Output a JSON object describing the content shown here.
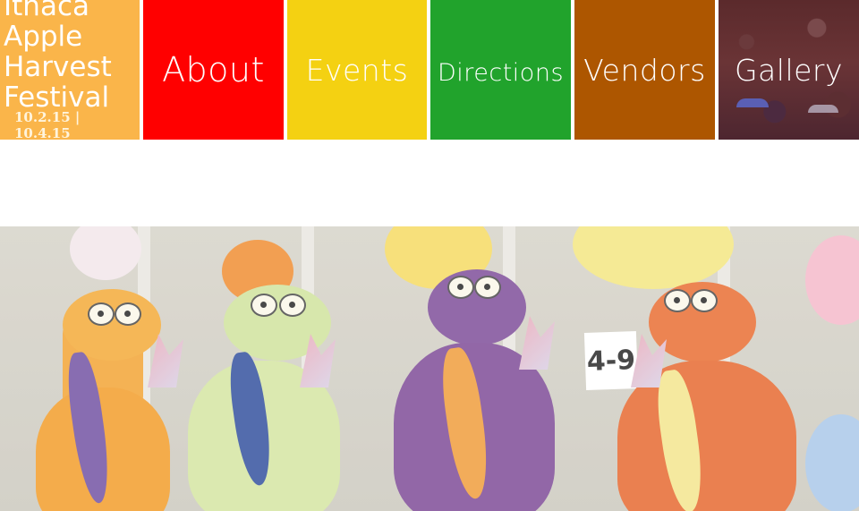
{
  "logo": {
    "lines": [
      "Ithaca",
      "Apple",
      "Harvest",
      "Festival"
    ],
    "dates": "10.2.15 | 10.4.15",
    "color": "#fab54a"
  },
  "nav": {
    "items": [
      {
        "label": "About",
        "color": "#ff0000"
      },
      {
        "label": "Events",
        "color": "#f4d112"
      },
      {
        "label": "Directions",
        "color": "#21a32c"
      },
      {
        "label": "Vendors",
        "color": "#ad5600"
      },
      {
        "label": "Gallery",
        "color": "#5b2a2c"
      }
    ]
  },
  "hero": {
    "sign_text": "4-9"
  }
}
